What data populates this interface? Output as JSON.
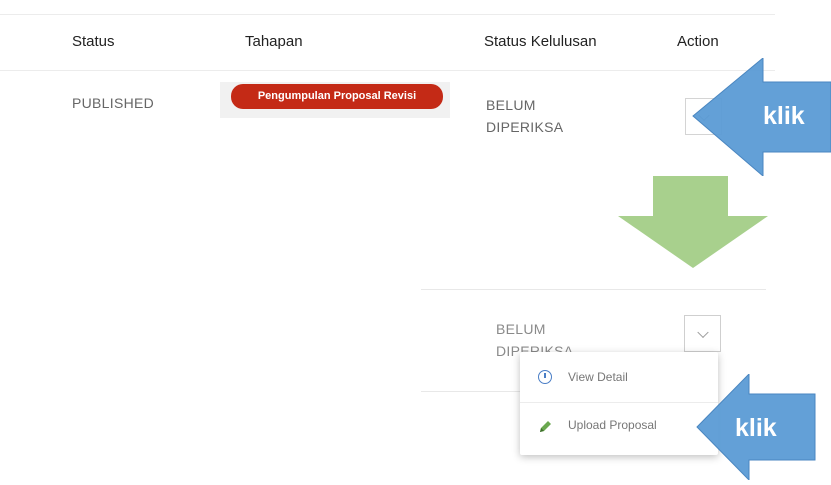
{
  "table": {
    "headers": {
      "status": "Status",
      "tahapan": "Tahapan",
      "status_kelulusan": "Status Kelulusan",
      "action": "Action"
    },
    "row": {
      "status": "PUBLISHED",
      "tahapan_badge": "Pengumpulan Proposal Revisi",
      "kelulusan_line1": "BELUM",
      "kelulusan_line2": "DIPERIKSA"
    }
  },
  "callouts": {
    "first": "klik",
    "second": "klik"
  },
  "zoomed": {
    "kelulusan_line1": "BELUM",
    "kelulusan_line2": "DIPERIKSA",
    "menu": {
      "view_detail": "View Detail",
      "upload_proposal": "Upload Proposal"
    }
  },
  "colors": {
    "badge": "#c42a16",
    "callout_blue": "#5b9bd5",
    "flow_arrow_green": "#a8d08d",
    "info_icon": "#4a7ec6",
    "pencil_icon": "#6aa84f"
  },
  "icons": {
    "action_button": "chevron-down-icon",
    "view_detail": "info-icon",
    "upload_proposal": "pencil-icon",
    "flow": "arrow-down-icon",
    "callout": "arrow-left-icon"
  }
}
